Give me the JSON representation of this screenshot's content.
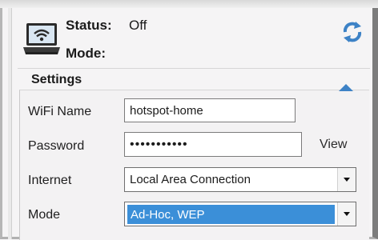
{
  "header": {
    "status_label": "Status:",
    "status_value": "Off",
    "mode_label": "Mode:",
    "icons": {
      "device": "laptop-wifi-icon",
      "refresh": "refresh-icon"
    }
  },
  "settings": {
    "title": "Settings",
    "collapse_icon": "chevron-up-icon",
    "wifi_name": {
      "label": "WiFi Name",
      "value": "hotspot-home"
    },
    "password": {
      "label": "Password",
      "value": "•••••••••••",
      "view_label": "View"
    },
    "internet": {
      "label": "Internet",
      "selected": "Local Area Connection"
    },
    "mode": {
      "label": "Mode",
      "selected": "Ad-Hoc, WEP"
    }
  },
  "colors": {
    "accent": "#3b8fd8",
    "icon_blue": "#3d82c6"
  }
}
